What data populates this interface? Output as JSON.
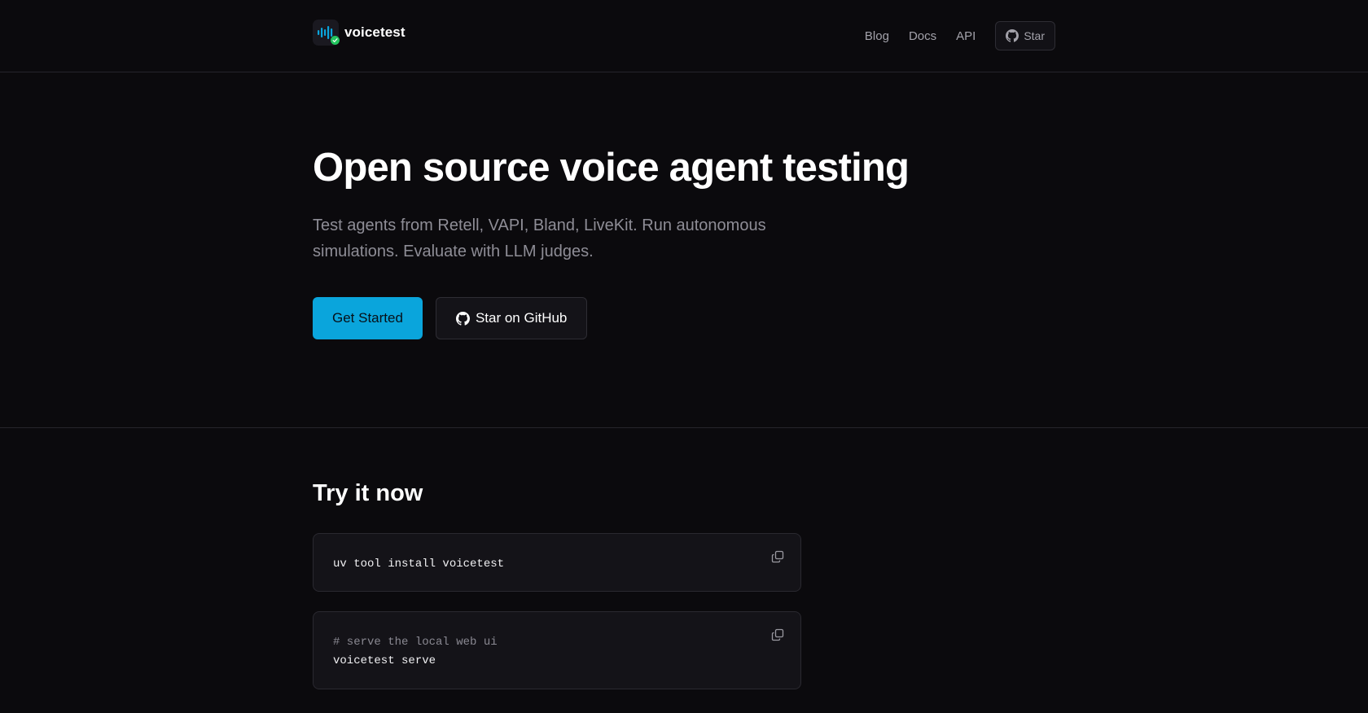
{
  "brand": {
    "name": "voicetest",
    "accent": "#0aa5dc",
    "check_color": "#22c55e"
  },
  "nav": {
    "links": [
      {
        "label": "Blog"
      },
      {
        "label": "Docs"
      },
      {
        "label": "API"
      }
    ],
    "star_label": "Star",
    "star_icon": "github-icon"
  },
  "hero": {
    "title": "Open source voice agent testing",
    "subtitle": "Test agents from Retell, VAPI, Bland, LiveKit. Run autonomous simulations. Evaluate with LLM judges.",
    "primary_button": "Get Started",
    "secondary_button": "Star on GitHub"
  },
  "try_it": {
    "title": "Try it now",
    "blocks": [
      {
        "lines": [
          "uv tool install voicetest"
        ],
        "copy_icon": "copy-icon"
      },
      {
        "comment": "# serve the local web ui",
        "lines": [
          "voicetest serve"
        ],
        "copy_icon": "copy-icon"
      }
    ]
  },
  "colors": {
    "background": "#0b0a0d",
    "surface": "#141318",
    "border": "#2a2930",
    "muted_text": "#8e8d96"
  }
}
